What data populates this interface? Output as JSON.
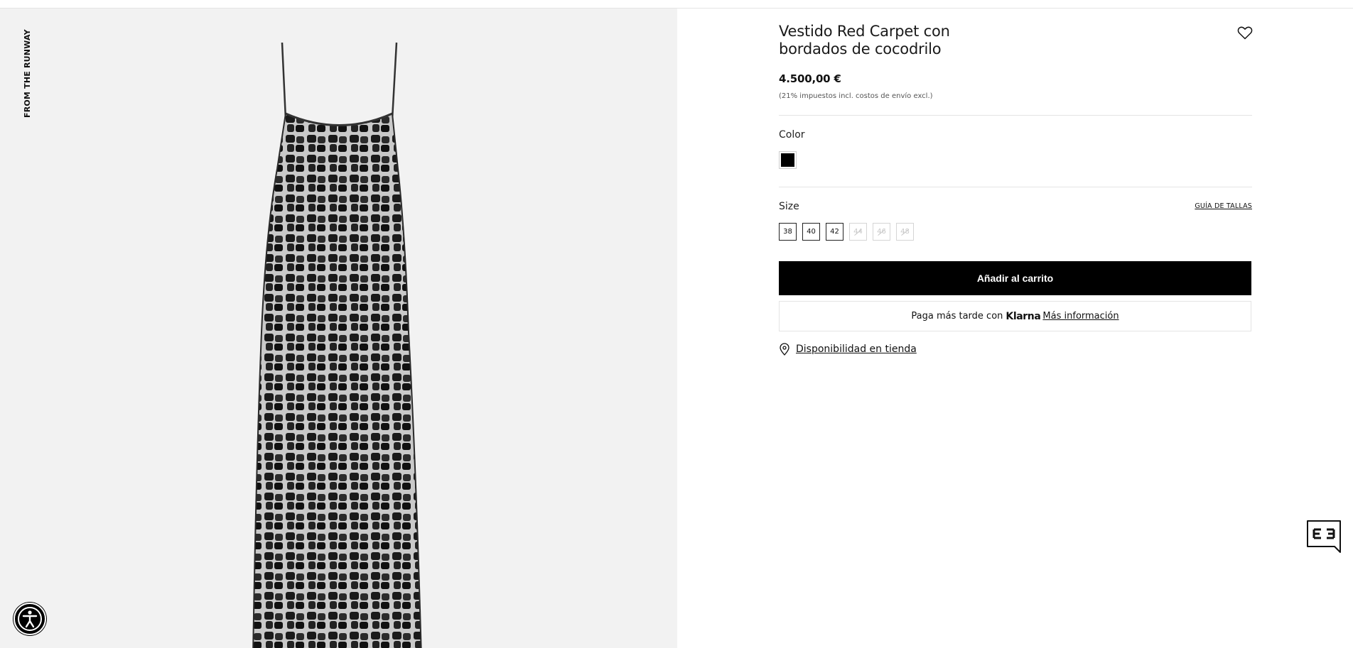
{
  "gallery": {
    "tag": "FROM THE RUNWAY",
    "image_icon": "dress-photo"
  },
  "product": {
    "title_line1": "Vestido Red Carpet con",
    "title_line2": "bordados de cocodrilo",
    "price": "4.500,00 €",
    "tax_note": "(21% impuestos incl. costos de envío excl.)",
    "wishlist_icon": "heart-icon"
  },
  "color": {
    "label": "Color",
    "selected_hex": "#000000"
  },
  "size": {
    "label": "Size",
    "guide_link": "GUÍA DE TALLAS",
    "options": [
      {
        "label": "38",
        "available": true
      },
      {
        "label": "40",
        "available": true
      },
      {
        "label": "42",
        "available": true
      },
      {
        "label": "44",
        "available": false
      },
      {
        "label": "46",
        "available": false
      },
      {
        "label": "48",
        "available": false
      }
    ]
  },
  "actions": {
    "add_to_cart": "Añadir al carrito"
  },
  "klarna": {
    "text": "Paga más tarde con",
    "brand": "Klarna",
    "link": "Más información"
  },
  "store": {
    "icon": "location-pin-icon",
    "link": "Disponibilidad en tienda"
  },
  "widgets": {
    "accessibility_icon": "accessibility-icon",
    "chat_icon": "chat-bubble-icon"
  },
  "colors": {
    "gallery_bg": "#f2f2f2",
    "button_bg": "#000000",
    "button_text": "#ffffff"
  }
}
